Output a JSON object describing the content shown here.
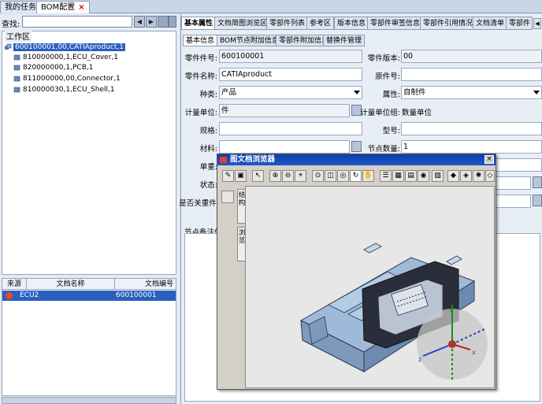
{
  "top_tabs": [
    "我的任务",
    "BOM配置"
  ],
  "left": {
    "search_label": "查找:",
    "work_area_label": "工作区",
    "tree": [
      "600100001,00,CATIAproduct,1",
      "810000000,1,ECU_Cover,1",
      "820000000,1,PCB,1",
      "811000000,00,Connector,1",
      "810000030,1,ECU_Shell,1"
    ],
    "doc_table": {
      "headers": [
        "来源",
        "文档名称",
        "文档编号"
      ],
      "rows": [
        {
          "source": "",
          "name": "ECU2",
          "number": "600100001"
        }
      ]
    }
  },
  "right": {
    "tabs": [
      "基本属性",
      "文档简图浏览区",
      "零部件列表",
      "参考区",
      "版本信息",
      "零部件审签信息",
      "零部件引用情况",
      "文档清单",
      "零部件"
    ],
    "subtabs": [
      "基本信息",
      "BOM节点附加信息",
      "零部件附加信息",
      "替换件管理"
    ],
    "fields": {
      "part_no_label": "零件件号:",
      "part_no": "600100001",
      "version_label": "零件版本:",
      "version": "00",
      "part_name_label": "零件名称:",
      "part_name": "CATIAproduct",
      "orig_no_label": "原件号:",
      "orig_no": "",
      "type_label": "种类:",
      "type": "产品",
      "attr_label": "属性:",
      "attr": "自制件",
      "unit_label": "计量单位:",
      "unit": "件",
      "unit_group_label": "计量单位组:",
      "unit_group": "数量单位",
      "spec_label": "规格:",
      "spec": "",
      "model_label": "型号:",
      "model": "",
      "material_label": "材料:",
      "material": "",
      "node_qty_label": "节点数量:",
      "node_qty": "1",
      "weight_label": "单重:",
      "status_label": "状态:",
      "key_part_label": "是否关重件:"
    },
    "notes_label": "节点备注信息"
  },
  "viewer": {
    "title": "图文档浏览器",
    "close": "×",
    "side_tabs": [
      "结构",
      "浏览"
    ]
  }
}
